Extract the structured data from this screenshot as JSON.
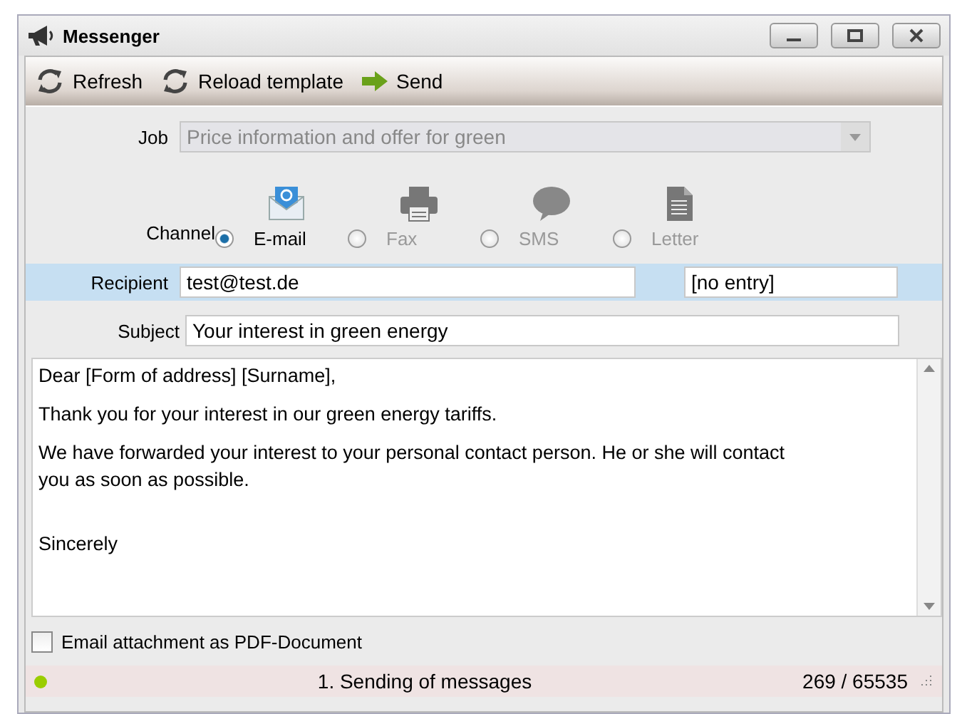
{
  "window": {
    "title": "Messenger"
  },
  "toolbar": [
    {
      "kind": "refresh",
      "label": "Refresh"
    },
    {
      "kind": "refresh",
      "label": "Reload template"
    },
    {
      "kind": "send",
      "label": "Send"
    }
  ],
  "job": {
    "label": "Job",
    "value": "Price information and offer for green",
    "disabled": true
  },
  "channel": {
    "label": "Channel",
    "options": [
      {
        "kind": "email",
        "label": "E-mail",
        "selected": true,
        "disabled": false
      },
      {
        "kind": "fax",
        "label": "Fax",
        "selected": false,
        "disabled": true
      },
      {
        "kind": "sms",
        "label": "SMS",
        "selected": false,
        "disabled": true
      },
      {
        "kind": "letter",
        "label": "Letter",
        "selected": false,
        "disabled": true
      }
    ]
  },
  "recipient": {
    "label": "Recipient",
    "value": "test@test.de",
    "second_value": "[no entry]"
  },
  "subject": {
    "label": "Subject",
    "value": "Your interest in green energy"
  },
  "body": [
    "Dear [Form of address] [Surname],",
    "Thank you for your interest in our green energy tariffs.",
    "We have forwarded your interest to your personal contact person. He or she will contact you as soon as possible.",
    "Sincerely"
  ],
  "pdf_attachment": {
    "label": "Email attachment as PDF-Document",
    "checked": false
  },
  "status_bar": {
    "color": "#9acd00",
    "message": "1. Sending of messages",
    "count": "269 / 65535"
  }
}
